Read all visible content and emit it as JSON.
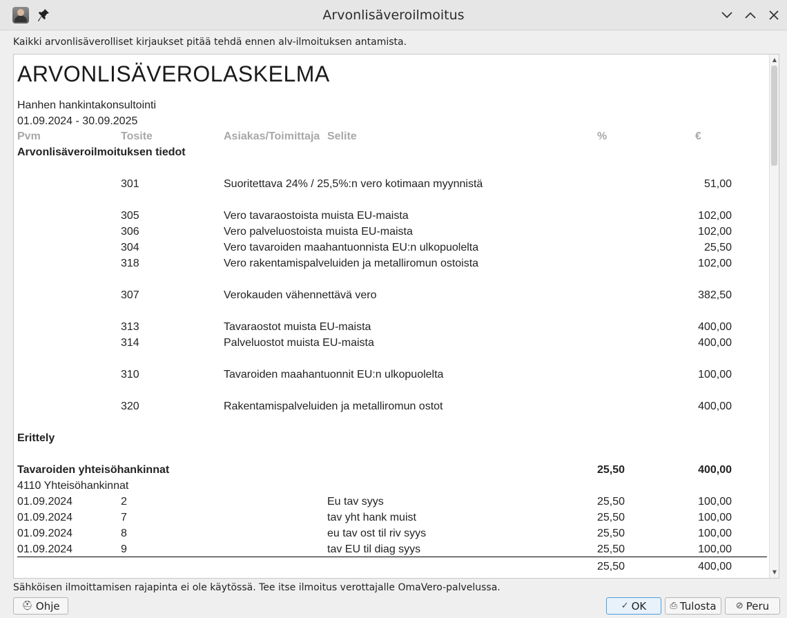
{
  "window": {
    "title": "Arvonlisäveroilmoitus"
  },
  "info_top": "Kaikki arvonlisäverolliset kirjaukset pitää tehdä ennen alv-ilmoituksen antamista.",
  "report": {
    "title": "ARVONLISÄVEROLASKELMA",
    "company": "Hanhen hankintakonsultointi",
    "period": "01.09.2024 - 30.09.2025",
    "headers": {
      "date": "Pvm",
      "voucher": "Tosite",
      "party": "Asiakas/Toimittaja",
      "text": "Selite",
      "percent": "%",
      "euro": "€"
    },
    "section_info": "Arvonlisäveroilmoituksen tiedot",
    "declaration_rows": [
      {
        "code": "301",
        "desc": "Suoritettava 24% / 25,5%:n vero kotimaan myynnistä",
        "amount": "51,00"
      },
      {
        "code": "305",
        "desc": "Vero tavaraostoista muista EU-maista",
        "amount": "102,00"
      },
      {
        "code": "306",
        "desc": "Vero palveluostoista muista EU-maista",
        "amount": "102,00"
      },
      {
        "code": "304",
        "desc": "Vero tavaroiden maahantuonnista EU:n ulkopuolelta",
        "amount": "25,50"
      },
      {
        "code": "318",
        "desc": "Vero rakentamispalveluiden ja metalliromun ostoista",
        "amount": "102,00"
      },
      {
        "code": "307",
        "desc": "Verokauden vähennettävä vero",
        "amount": "382,50"
      },
      {
        "code": "313",
        "desc": "Tavaraostot muista EU-maista",
        "amount": "400,00"
      },
      {
        "code": "314",
        "desc": "Palveluostot muista EU-maista",
        "amount": "400,00"
      },
      {
        "code": "310",
        "desc": "Tavaroiden maahantuonnit EU:n ulkopuolelta",
        "amount": "100,00"
      },
      {
        "code": "320",
        "desc": "Rakentamispalveluiden ja metalliromun ostot",
        "amount": "400,00"
      }
    ],
    "section_breakdown": "Erittely",
    "group": {
      "title": "Tavaroiden yhteisöhankinnat",
      "percent": "25,50",
      "amount": "400,00",
      "account": "4110 Yhteisöhankinnat"
    },
    "entries": [
      {
        "date": "01.09.2024",
        "voucher": "2",
        "text": "Eu tav syys",
        "percent": "25,50",
        "amount": "100,00"
      },
      {
        "date": "01.09.2024",
        "voucher": "7",
        "text": "tav yht hank muist",
        "percent": "25,50",
        "amount": "100,00"
      },
      {
        "date": "01.09.2024",
        "voucher": "8",
        "text": "eu tav ost til riv syys",
        "percent": "25,50",
        "amount": "100,00"
      },
      {
        "date": "01.09.2024",
        "voucher": "9",
        "text": "tav EU til diag syys",
        "percent": "25,50",
        "amount": "100,00"
      }
    ],
    "total": {
      "percent": "25,50",
      "amount": "400,00"
    }
  },
  "info_bottom": "Sähköisen ilmoittamisen rajapinta ei ole käytössä. Tee itse ilmoitus verottajalle OmaVero-palvelussa.",
  "buttons": {
    "help": "Ohje",
    "ok": "OK",
    "print": "Tulosta",
    "cancel": "Peru"
  }
}
